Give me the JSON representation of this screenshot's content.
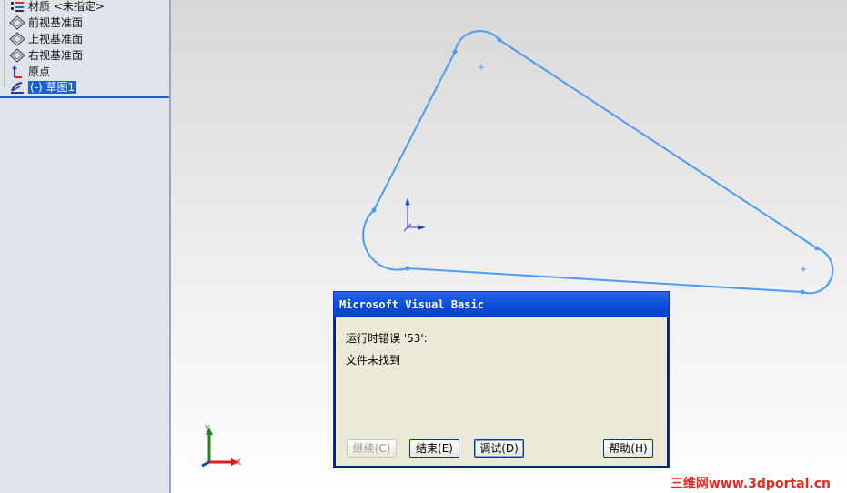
{
  "feature_tree": {
    "items": [
      {
        "label": "材质 <未指定>",
        "icon": "material-icon"
      },
      {
        "label": "前视基准面",
        "icon": "plane-icon"
      },
      {
        "label": "上视基准面",
        "icon": "plane-icon"
      },
      {
        "label": "右视基准面",
        "icon": "plane-icon"
      },
      {
        "label": "原点",
        "icon": "origin-icon"
      },
      {
        "label": "(-) 草图1",
        "icon": "sketch-icon",
        "selected": true
      }
    ]
  },
  "viewport": {
    "triad": {
      "x_label": "X",
      "y_label": "Y"
    },
    "colors": {
      "sketch": "#4d9cf0",
      "axis_x": "#d52020",
      "axis_y": "#1a8a1a",
      "axis_z": "#2040c0"
    }
  },
  "dialog": {
    "title": "Microsoft Visual Basic",
    "error_line": "运行时错误 '53':",
    "message": "文件未找到",
    "buttons": {
      "continue": "继续(C)",
      "end": "结束(E)",
      "debug": "调试(D)",
      "help": "帮助(H)"
    }
  },
  "watermark": "三维网www.3dportal.cn"
}
